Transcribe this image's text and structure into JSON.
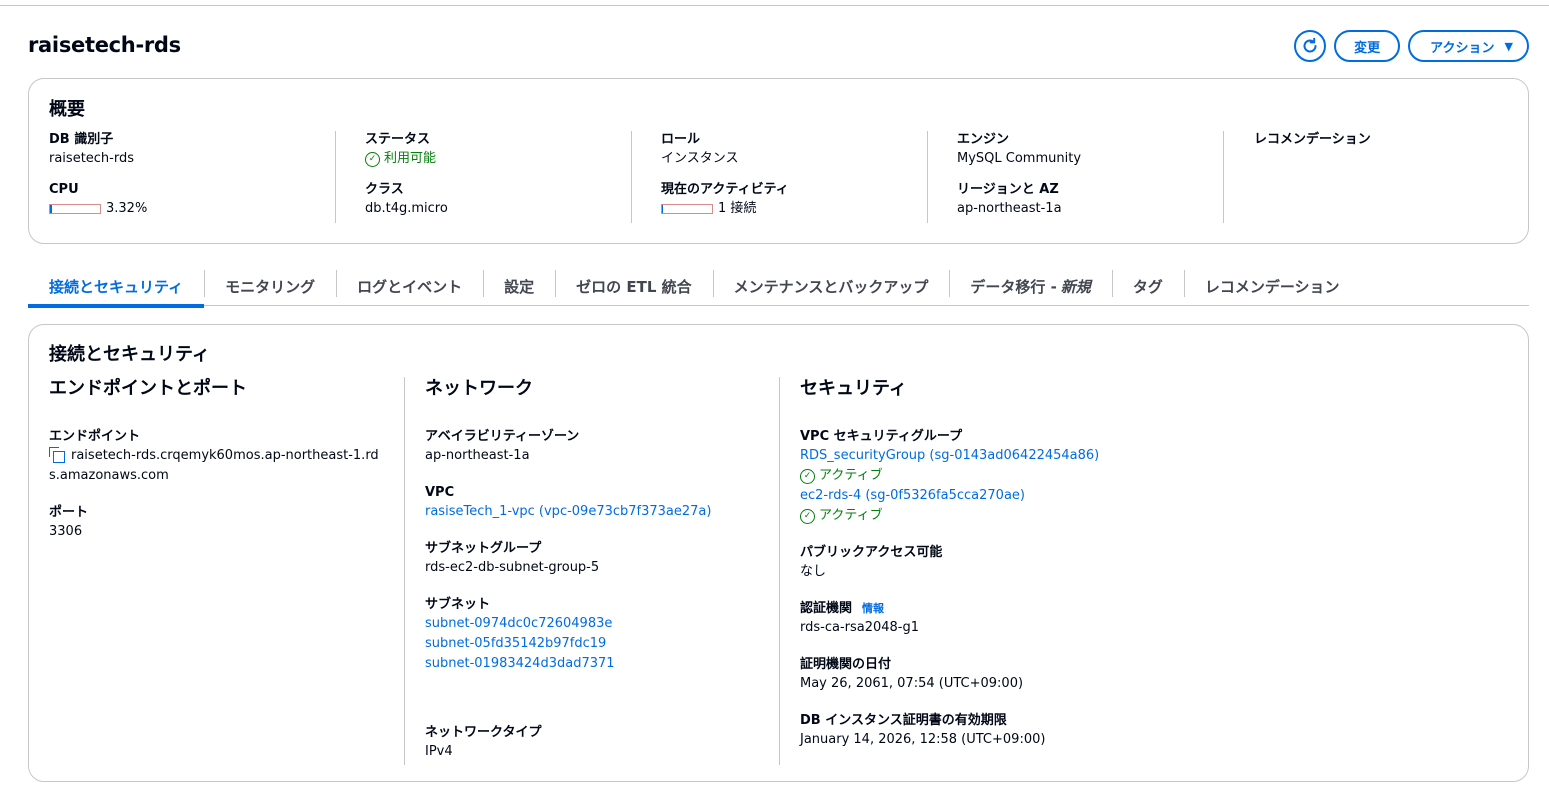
{
  "header": {
    "title": "raisetech-rds",
    "refresh_icon": "refresh-icon",
    "modify_label": "変更",
    "actions_label": "アクション",
    "actions_caret": "▼"
  },
  "summary": {
    "title": "概要",
    "db_identifier": {
      "label": "DB 識別子",
      "value": "raisetech-rds"
    },
    "cpu": {
      "label": "CPU",
      "value": "3.32%",
      "fraction": 0.0332
    },
    "status": {
      "label": "ステータス",
      "value": "利用可能",
      "icon": "check-circle-icon"
    },
    "class": {
      "label": "クラス",
      "value": "db.t4g.micro"
    },
    "role": {
      "label": "ロール",
      "value": "インスタンス"
    },
    "activity": {
      "label": "現在のアクティビティ",
      "value": "1 接続",
      "fraction": 0.02
    },
    "engine": {
      "label": "エンジン",
      "value": "MySQL Community"
    },
    "region": {
      "label": "リージョンと AZ",
      "value": "ap-northeast-1a"
    },
    "recommendations": {
      "label": "レコメンデーション"
    }
  },
  "tabs": [
    {
      "label": "接続とセキュリティ",
      "active": true
    },
    {
      "label": "モニタリング"
    },
    {
      "label": "ログとイベント"
    },
    {
      "label": "設定"
    },
    {
      "label": "ゼロの ETL 統合"
    },
    {
      "label": "メンテナンスとバックアップ"
    },
    {
      "label": "データ移行 -",
      "suffix": "新規"
    },
    {
      "label": "タグ"
    },
    {
      "label": "レコメンデーション"
    }
  ],
  "connectivity": {
    "title": "接続とセキュリティ",
    "endpoint_port": {
      "heading": "エンドポイントとポート",
      "endpoint_label": "エンドポイント",
      "endpoint_line1": "raisetech-rds.crqemyk60mos.ap-northeast-1.rd",
      "endpoint_line2": "s.amazonaws.com",
      "port_label": "ポート",
      "port_value": "3306"
    },
    "network": {
      "heading": "ネットワーク",
      "az_label": "アベイラビリティーゾーン",
      "az_value": "ap-northeast-1a",
      "vpc_label": "VPC",
      "vpc_value": "rasiseTech_1-vpc (vpc-09e73cb7f373ae27a)",
      "subnet_group_label": "サブネットグループ",
      "subnet_group_value": "rds-ec2-db-subnet-group-5",
      "subnets_label": "サブネット",
      "subnets": [
        "subnet-0974dc0c72604983e",
        "subnet-05fd35142b97fdc19",
        "subnet-01983424d3dad7371"
      ],
      "network_type_label": "ネットワークタイプ",
      "network_type_value": "IPv4"
    },
    "security": {
      "heading": "セキュリティ",
      "sg_label": "VPC セキュリティグループ",
      "sg1": "RDS_securityGroup (sg-0143ad06422454a86)",
      "sg1_status": "アクティブ",
      "sg2": "ec2-rds-4 (sg-0f5326fa5cca270ae)",
      "sg2_status": "アクティブ",
      "public_label": "パブリックアクセス可能",
      "public_value": "なし",
      "ca_label": "認証機関",
      "ca_info": "情報",
      "ca_value": "rds-ca-rsa2048-g1",
      "ca_date_label": "証明機関の日付",
      "ca_date_value": "May 26, 2061, 07:54 (UTC+09:00)",
      "cert_expiry_label": "DB インスタンス証明書の有効期限",
      "cert_expiry_value": "January 14, 2026, 12:58 (UTC+09:00)"
    }
  }
}
